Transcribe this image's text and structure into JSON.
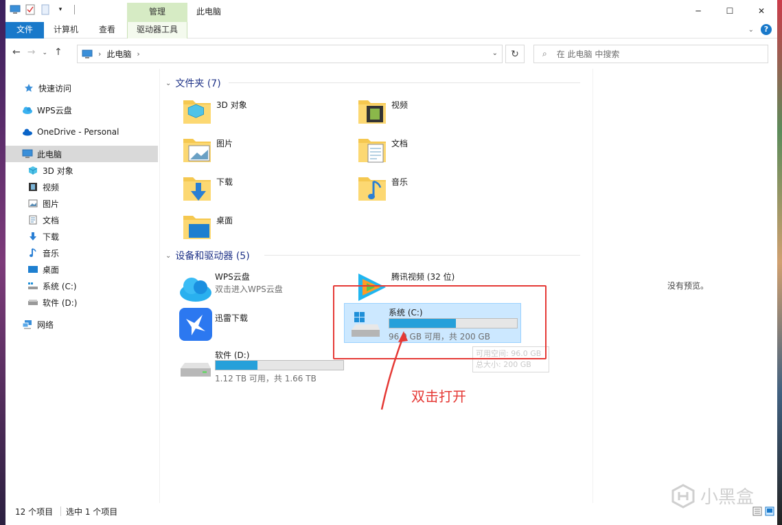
{
  "titlebar": {
    "manage_tab": "管理",
    "title": "此电脑",
    "minimize": "─",
    "maximize": "☐",
    "close": "✕"
  },
  "ribbon": {
    "file": "文件",
    "computer": "计算机",
    "view": "查看",
    "drive_tools": "驱动器工具",
    "help": "?"
  },
  "address": {
    "path": "此电脑",
    "search_placeholder": "在 此电脑 中搜索"
  },
  "sidebar": {
    "items": [
      {
        "label": "快速访问"
      },
      {
        "label": "WPS云盘"
      },
      {
        "label": "OneDrive - Personal"
      },
      {
        "label": "此电脑"
      },
      {
        "label": "3D 对象"
      },
      {
        "label": "视频"
      },
      {
        "label": "图片"
      },
      {
        "label": "文档"
      },
      {
        "label": "下载"
      },
      {
        "label": "音乐"
      },
      {
        "label": "桌面"
      },
      {
        "label": "系统 (C:)"
      },
      {
        "label": "软件 (D:)"
      },
      {
        "label": "网络"
      }
    ]
  },
  "main": {
    "folders_header": "文件夹 (7)",
    "folders": [
      {
        "label": "3D 对象"
      },
      {
        "label": "视频"
      },
      {
        "label": "图片"
      },
      {
        "label": "文档"
      },
      {
        "label": "下载"
      },
      {
        "label": "音乐"
      },
      {
        "label": "桌面"
      }
    ],
    "devices_header": "设备和驱动器 (5)",
    "wps": {
      "name": "WPS云盘",
      "sub": "双击进入WPS云盘"
    },
    "tencent": {
      "name": "腾讯视频 (32 位)"
    },
    "xunlei": {
      "name": "迅雷下载"
    },
    "c_drive": {
      "name": "系统 (C:)",
      "info": "96.0 GB 可用，共 200 GB",
      "used_fraction": 0.52
    },
    "d_drive": {
      "name": "软件 (D:)",
      "info": "1.12 TB 可用，共 1.66 TB",
      "used_fraction": 0.33
    },
    "tooltip_line1": "可用空间: 96.0 GB",
    "tooltip_line2": "总大小: 200 GB"
  },
  "annotation": {
    "text": "双击打开",
    "color": "#e53935"
  },
  "preview": {
    "text": "没有预览。"
  },
  "status": {
    "count": "12 个项目",
    "selected": "选中 1 个项目"
  },
  "watermark": {
    "text": "小黑盒"
  },
  "colors": {
    "accent": "#1979ca",
    "bar_fill": "#26a0da",
    "selection": "#cce8ff",
    "manage_tab": "#d6ebc4"
  }
}
